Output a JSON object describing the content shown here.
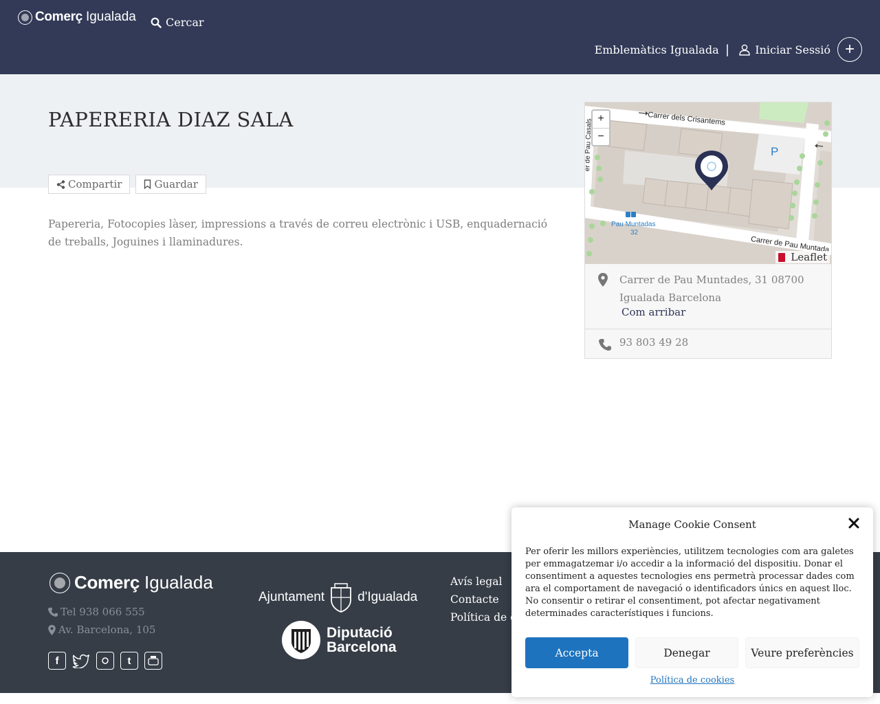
{
  "header": {
    "logo_bold": "Comerç",
    "logo_light": "Igualada",
    "search_label": "Cercar",
    "nav_link": "Emblemàtics Igualada",
    "separator": "|",
    "login_label": "Iniciar Sessió",
    "add_label": "+"
  },
  "listing": {
    "title": "PAPERERIA DIAZ SALA",
    "share_label": "Compartir",
    "save_label": "Guardar",
    "description": "Papereria, Fotocopies làser, impressions a través de correu electrònic i USB, enquadernació de treballs, Joguines i llaminadures."
  },
  "map": {
    "zoom_in": "+",
    "zoom_out": "−",
    "street_top": "Carrer dels Crisantems",
    "street_bottom": "Carrer de Pau Muntada",
    "street_left": "er de Pau Casals",
    "bus_stop": "Pau Muntadas",
    "bus_stop_number": "32",
    "parking": "P",
    "attribution": "Leaflet"
  },
  "contact": {
    "address_line1": "Carrer de Pau Muntades, 31 08700",
    "address_line2": "Igualada Barcelona",
    "directions_label": "Com arribar",
    "phone": "93 803 49 28"
  },
  "footer": {
    "logo_bold": "Comerç",
    "logo_light": "Igualada",
    "tel": "Tel 938 066 555",
    "address": "Av. Barcelona, 105",
    "social_icons": [
      "facebook-icon",
      "twitter-icon",
      "instagram-icon",
      "tumblr-icon",
      "youtube-icon"
    ],
    "ajuntament_left": "Ajuntament",
    "ajuntament_right": "d'Igualada",
    "diputacio_line1": "Diputació",
    "diputacio_line2": "Barcelona",
    "links": [
      "Avís legal",
      "Contacte",
      "Política de cookies"
    ]
  },
  "cookie": {
    "title": "Manage Cookie Consent",
    "text": "Per oferir les millors experiències, utilitzem tecnologies com ara galetes per emmagatzemar i/o accedir a la informació del dispositiu. Donar el consentiment a aquestes tecnologies ens permetrà processar dades com ara el comportament de navegació o identificadors únics en aquest lloc. No consentir o retirar el consentiment, pot afectar negativament determinades característiques i funcions.",
    "accept": "Accepta",
    "deny": "Denegar",
    "preferences": "Veure preferències",
    "policy_link": "Política de cookies"
  },
  "colors": {
    "header_bg": "#323a57",
    "footer_bg": "#363d47",
    "accept_button": "#1e73be",
    "band_bg": "#eef1f4"
  }
}
